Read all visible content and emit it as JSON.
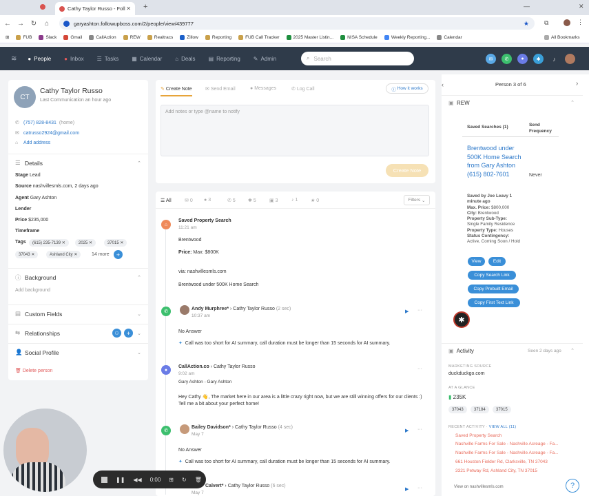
{
  "browser": {
    "tab_title": "Cathy Taylor Russo - Foll",
    "url": "garyashton.followupboss.com/2/people/view/439777",
    "bookmarks": [
      "FUB",
      "Slack",
      "Gmail",
      "CallAction",
      "REW",
      "Realtracs",
      "Zillow",
      "Reporting",
      "FUB Call Tracker",
      "2025 Master Listin...",
      "NISA Schedule",
      "Weekly Reporting...",
      "Calendar"
    ],
    "all_bookmarks": "All Bookmarks"
  },
  "nav": {
    "items": [
      {
        "label": "People",
        "icon": "people-icon",
        "active": true
      },
      {
        "label": "Inbox",
        "icon": "inbox-icon"
      },
      {
        "label": "Tasks",
        "icon": "tasks-icon"
      },
      {
        "label": "Calendar",
        "icon": "calendar-icon"
      },
      {
        "label": "Deals",
        "icon": "deals-icon"
      },
      {
        "label": "Reporting",
        "icon": "reporting-icon"
      },
      {
        "label": "Admin",
        "icon": "admin-icon"
      }
    ],
    "search_placeholder": "Search"
  },
  "person": {
    "initials": "CT",
    "name": "Cathy Taylor Russo",
    "last_comm": "Last Communication an hour ago",
    "phone": "(757) 828-8431",
    "phone_type": "(home)",
    "email": "catrusso2924@gmail.com",
    "add_address": "Add address"
  },
  "details": {
    "title": "Details",
    "stage_label": "Stage",
    "stage": "Lead",
    "source_label": "Source",
    "source": "nashvillesmls.com, 2 days ago",
    "agent_label": "Agent",
    "agent": "Gary Ashton",
    "lender_label": "Lender",
    "price_label": "Price",
    "price": "$235,000",
    "timeframe_label": "Timeframe",
    "tags_label": "Tags",
    "tags": [
      "(615) 235-7139",
      "2025",
      "37015",
      "37043",
      "Ashland City"
    ],
    "more_tags": "14 more"
  },
  "sections": {
    "background": "Background",
    "add_background": "Add background",
    "custom_fields": "Custom Fields",
    "relationships": "Relationships",
    "social_profile": "Social Profile",
    "delete": "Delete person"
  },
  "composer": {
    "tabs": [
      "Create Note",
      "Send Email",
      "Messages",
      "Log Call"
    ],
    "how_it_works": "How it works",
    "placeholder": "Add notes or type @name to notify",
    "create_btn": "Create Note"
  },
  "timeline": {
    "tabs": [
      {
        "label": "All"
      },
      {
        "label": "0"
      },
      {
        "label": "3"
      },
      {
        "label": "5"
      },
      {
        "label": "5"
      },
      {
        "label": "3"
      },
      {
        "label": "1"
      },
      {
        "label": "0"
      }
    ],
    "filters": "Filters",
    "e1_title": "Saved Property Search",
    "e1_time": "11:21 am",
    "e1_l1": "Brentwood",
    "e1_l2_b": "Price:",
    "e1_l2": "Max: $800K",
    "e1_l3": "via: nashvillesmls.com",
    "e1_l4": "Brentwood under 500K Home Search",
    "e2_from": "Andy Murphree*",
    "e2_to": "Cathy Taylor Russo",
    "e2_dur": "(2 sec)",
    "e2_time": "10:37 am",
    "e2_status": "No Answer",
    "e2_ai": "Call was too short for AI summary, call duration must be longer than 15 seconds for AI summary.",
    "e3_from": "CallAction.co",
    "e3_to": "Cathy Taylor Russo",
    "e3_time": "9:02 am",
    "e3_agents": "Gary Ashton - Gary Ashton",
    "e3_msg": "Hey Cathy 👋, The market here in our area is a little crazy right now, but we are still winning offers for our clients :) Tell me a bit about your perfect home!",
    "e4_from": "Bailey Davidson*",
    "e4_to": "Cathy Taylor Russo",
    "e4_dur": "(4 sec)",
    "e4_time": "May 7",
    "e4_status": "No Answer",
    "e4_ai": "Call was too short for AI summary, call duration must be longer than 15 seconds for AI summary.",
    "e5_from": "Calvert*",
    "e5_to": "Cathy Taylor Russo",
    "e5_dur": "(6 sec)",
    "e5_time": "May 7"
  },
  "right": {
    "person_of": "Person 3 of 6",
    "rew_title": "REW",
    "col_saved": "Saved Searches (1)",
    "col_send": "Send Frequency",
    "search_link": "Brentwood under 500K Home Search from Gary Ashton (615) 802-7601",
    "frequency": "Never",
    "saved_by": "Saved by Joe Leavy 1 minute ago",
    "max_price_l": "Max. Price:",
    "max_price": "$800,000",
    "city_l": "City:",
    "city": "Brentwood",
    "subtype_l": "Property Sub-Type:",
    "subtype": "Single Family Residence",
    "ptype_l": "Property Type:",
    "ptype": "Houses",
    "status_l": "Status Contingency:",
    "status": "Active, Coming Soon / Hold",
    "btn_view": "View",
    "btn_edit": "Edit",
    "btn_copy_search": "Copy Search Link",
    "btn_copy_email": "Copy Prebuilt Email",
    "btn_copy_text": "Copy First Text Link",
    "activity_title": "Activity",
    "activity_seen": "Seen 2 days ago",
    "ms_label": "MARKETING SOURCE",
    "ms": "duckduckgo.com",
    "aag_label": "AT A GLANCE",
    "aag_price": "235K",
    "zips": [
      "37043",
      "37184",
      "37015"
    ],
    "ra_label": "RECENT ACTIVITY",
    "ra_viewall": "VIEW ALL (11)",
    "ra": [
      "Saved Property Search",
      "Nashville Farms For Sale - Nashville Acreage - Fa...",
      "Nashville Farms For Sale - Nashville Acreage - Fa...",
      "661 Houston Fielder Rd, Clarksville, TN 37043",
      "3321 Petway Rd, Ashland City, TN 37015"
    ],
    "view_on": "View on nashvillesmls.com"
  },
  "recorder": {
    "time": "0:00"
  }
}
